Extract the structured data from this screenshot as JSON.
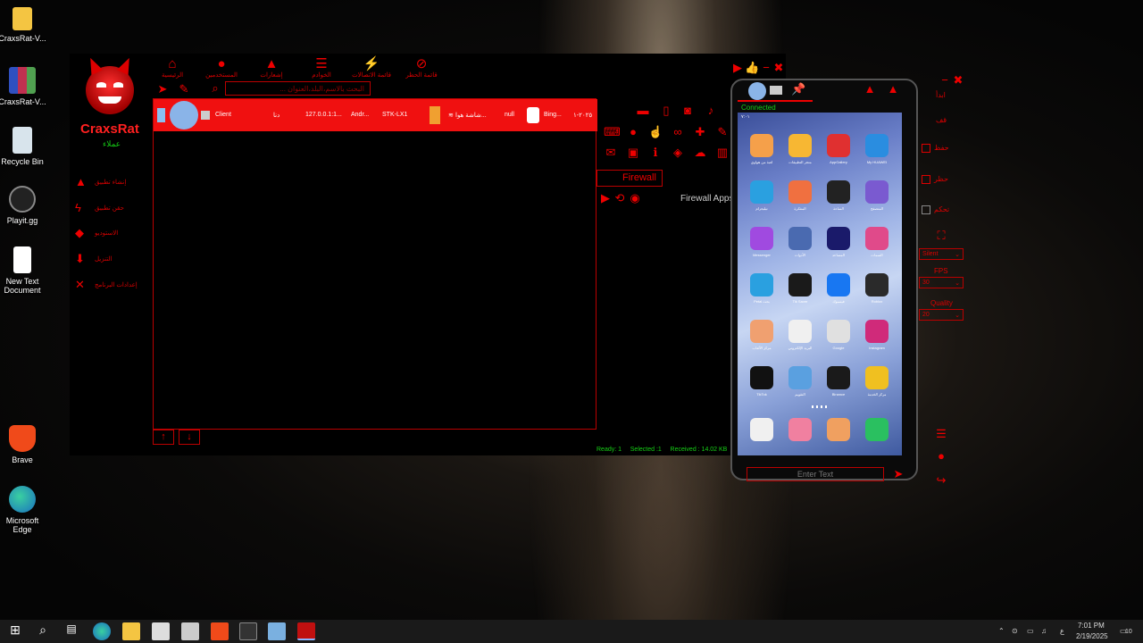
{
  "desktop": {
    "icons": [
      {
        "label": "CraxsRat-V...",
        "icon": "folder-icon"
      },
      {
        "label": "CraxsRat-V...",
        "icon": "winrar-icon"
      },
      {
        "label": "Recycle Bin",
        "icon": "recycle-bin-icon"
      },
      {
        "label": "Playit.gg",
        "icon": "playit-icon"
      },
      {
        "label": "New Text Document",
        "icon": "text-document-icon"
      },
      {
        "label": "Brave",
        "icon": "brave-icon"
      },
      {
        "label": "Microsoft Edge",
        "icon": "edge-icon"
      }
    ]
  },
  "app": {
    "brand": "CraxsRat",
    "brand_sub": "عملاء",
    "top_nav": [
      {
        "label": "الرئيسية",
        "icon": "home-icon"
      },
      {
        "label": "المستخدمين",
        "icon": "user-icon"
      },
      {
        "label": "إشعارات",
        "icon": "bell-icon"
      },
      {
        "label": "الخوادم",
        "icon": "list-icon"
      },
      {
        "label": "قائمة الاتصالات",
        "icon": "plug-icon"
      },
      {
        "label": "قائمة الحظر",
        "icon": "ban-icon"
      }
    ],
    "search_placeholder": "البحث بالاسم،البلد،العنوان ...",
    "sidebar": [
      {
        "label": "إنشاء تطبيق",
        "icon": "android-icon"
      },
      {
        "label": "حقن تطبيق",
        "icon": "bolt-icon"
      },
      {
        "label": "الاستوديو",
        "icon": "dropbox-icon"
      },
      {
        "label": "التنزيل",
        "icon": "download-icon"
      },
      {
        "label": "إعدادات البرنامج",
        "icon": "tools-icon"
      }
    ],
    "client_row": {
      "name": "Client",
      "country": "دنا",
      "ip": "127.0.0.1:1...",
      "os": "Andr...",
      "model": "STK-LX1",
      "screen": "شاشة هوا...",
      "status": "null",
      "app": "Bing...",
      "date": "٢٠٢٥-١"
    },
    "firewall_button": "Firewall",
    "firewall_apps": "Firewall Apps",
    "status": {
      "ready": "Ready: 1",
      "selected": "Selected :1",
      "received": "Received : 14.02 KB"
    }
  },
  "phone": {
    "connected": "Connected",
    "status_time": "٧:٠١",
    "enter_text_placeholder": "Enter Text",
    "apps": [
      {
        "label": "لعبة من هواوي",
        "color": "#f5a04a"
      },
      {
        "label": "متجر التطبيقات",
        "color": "#f7b733"
      },
      {
        "label": "AppGallery",
        "color": "#e03030"
      },
      {
        "label": "My HUAWEI",
        "color": "#2a8de0"
      },
      {
        "label": "تيليجرام",
        "color": "#2aa0e0"
      },
      {
        "label": "المفكرة",
        "color": "#f07040"
      },
      {
        "label": "الساعة",
        "color": "#222222"
      },
      {
        "label": "المتصفح",
        "color": "#7a5ad0"
      },
      {
        "label": "Messenger",
        "color": "#a04ae0"
      },
      {
        "label": "الأدوات",
        "color": "#4a6ab0"
      },
      {
        "label": "المساعد",
        "color": "#1a1a6a"
      },
      {
        "label": "السمات",
        "color": "#e04a8a"
      },
      {
        "label": "Petal بحث",
        "color": "#2aa0e0"
      },
      {
        "label": "Tik Saver",
        "color": "#1a1a1a"
      },
      {
        "label": "فيسبوك",
        "color": "#1877f2"
      },
      {
        "label": "Roblox",
        "color": "#2a2a2a"
      },
      {
        "label": "مركز الألعاب",
        "color": "#f0a070"
      },
      {
        "label": "البريد الإلكتروني",
        "color": "#f0f0f0"
      },
      {
        "label": "Google",
        "color": "#e0e0e0"
      },
      {
        "label": "Instagram",
        "color": "#d02a7a"
      },
      {
        "label": "TikTok",
        "color": "#111111"
      },
      {
        "label": "التقويم",
        "color": "#5aa0e0"
      },
      {
        "label": "Binance",
        "color": "#1a1a1a"
      },
      {
        "label": "مركز الخدمة",
        "color": "#f0c020"
      }
    ],
    "dock": [
      {
        "label": "Chrome",
        "color": "#f0f0f0"
      },
      {
        "label": "Photos",
        "color": "#f080a0"
      },
      {
        "label": "Contacts",
        "color": "#f0a060"
      },
      {
        "label": "Phone",
        "color": "#2ac060"
      }
    ]
  },
  "right_panel": {
    "start": "ابدأ",
    "stop": "قف",
    "save": "حفظ",
    "block": "حظر",
    "control": "تحكم",
    "mode_select": "Silent",
    "fps_label": "FPS",
    "fps_value": "30",
    "quality_label": "Quality",
    "quality_value": "20"
  },
  "taskbar": {
    "time": "7:01 PM",
    "date": "2/19/2025",
    "lang": "ع",
    "notif_count": "10"
  }
}
